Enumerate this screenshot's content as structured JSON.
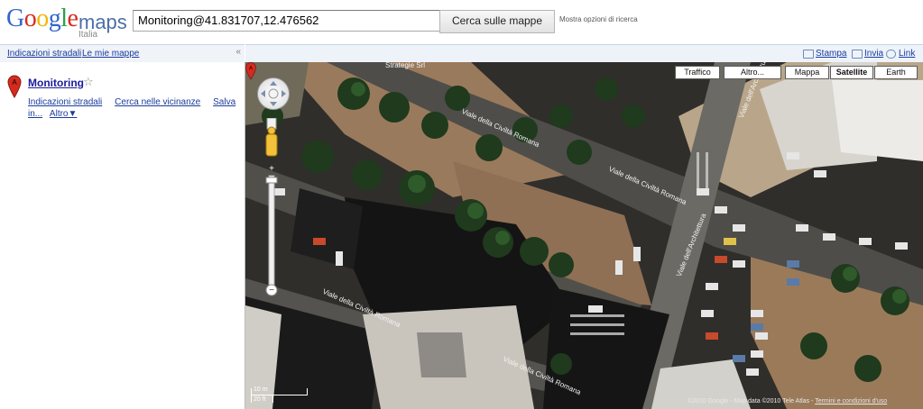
{
  "header": {
    "logo_word": "Google",
    "logo_product": "maps",
    "logo_region": "Italia",
    "search_value": "Monitoring@41.831707,12.476562",
    "search_button": "Cerca sulle mappe",
    "more_options": "Mostra opzioni di ricerca"
  },
  "subbar": {
    "directions": "Indicazioni stradali",
    "my_maps": "Le mie mappe",
    "collapse": "«"
  },
  "rightbar": {
    "print": "Stampa",
    "send": "Invia",
    "link": "Link"
  },
  "result": {
    "marker_letter": "A",
    "title": "Monitoring",
    "directions": "Indicazioni stradali",
    "nearby": "Cerca nelle vicinanze",
    "save": "Salva",
    "save_in": "in...",
    "more": "Altro▼"
  },
  "map": {
    "traffic": "Traffico",
    "more": "Altro...",
    "map": "Mappa",
    "satellite": "Satellite",
    "earth": "Earth",
    "selected_type": "Satellite",
    "road_labels": [
      "Viale della Civiltà Romana",
      "Viale della Civiltà Romana",
      "Viale della Civiltà Romana",
      "Viale della Civiltà Romana",
      "Viale dell'Architettura",
      "Viale dell'Architettura"
    ],
    "poi_label": "Strategie Srl",
    "marker_letter": "A",
    "scale_m": "10 m",
    "scale_ft": "20 ft",
    "copyright": "©2010 Google - Map data ©2010 Tele Atlas - ",
    "terms": "Termini e condizioni d'uso"
  },
  "colors": {
    "link": "#1a3c9c",
    "logo_blue": "#3366cc",
    "logo_red": "#d82a20",
    "logo_yellow": "#f2b705",
    "logo_green": "#2c9f45",
    "marker_red": "#d52b1e"
  },
  "icons": [
    "pan-control-icon",
    "pegman-icon",
    "zoom-in-icon",
    "zoom-out-icon",
    "star-icon",
    "print-icon",
    "mail-icon",
    "link-icon",
    "marker-icon"
  ]
}
